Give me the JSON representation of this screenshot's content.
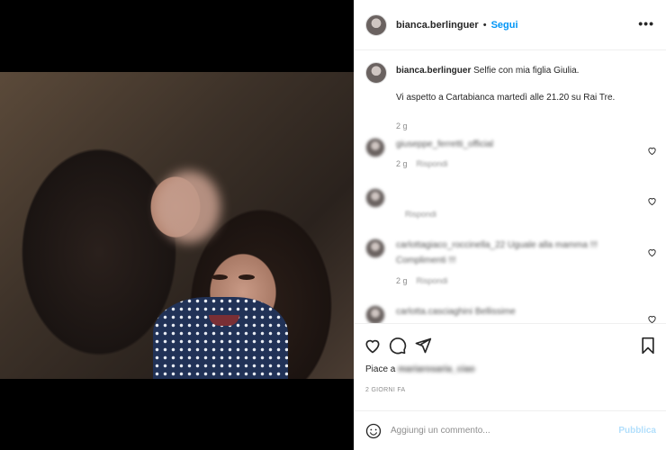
{
  "post": {
    "username": "bianca.berlinguer",
    "follow_label": "Segui",
    "separator": "•",
    "more_label": "•••"
  },
  "caption": {
    "username": "bianca.berlinguer",
    "text": "Selfie con mia figlia Giulia.",
    "line2": "Vi aspetto a Cartabianca martedì alle 21.20 su Rai Tre.",
    "time": "2 g"
  },
  "comments": [
    {
      "name": "giuseppe_ferretti_official",
      "line2": "",
      "time": "2 g",
      "reply": "Rispondi"
    },
    {
      "name": "",
      "line2": "",
      "time": "",
      "reply": "Rispondi"
    },
    {
      "name": "carlottagiaco_roccinella_22 Uguale alla mamma !!!",
      "line2": "Complimenti !!!",
      "time": "2 g",
      "reply": "Rispondi"
    },
    {
      "name": "carlotta.casciaghini Bellissime",
      "line2": "",
      "time": "",
      "reply": ""
    }
  ],
  "likes": {
    "prefix": "Piace a",
    "who": "mariarosaria_ciao"
  },
  "ago": "2 GIORNI FA",
  "composer": {
    "placeholder": "Aggiungi un commento...",
    "publish_label": "Pubblica"
  },
  "icons": {
    "like": "heart-icon",
    "comment": "comment-icon",
    "share": "share-icon",
    "save": "bookmark-icon",
    "emoji": "emoji-icon",
    "more": "more-icon"
  }
}
